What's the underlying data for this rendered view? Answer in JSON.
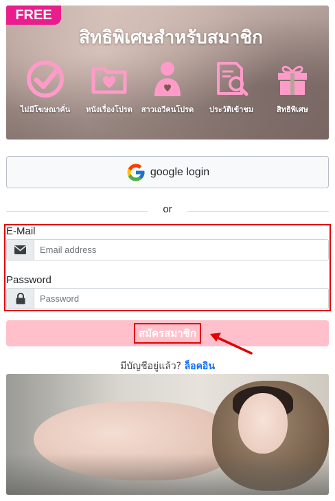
{
  "banner": {
    "badge": "FREE",
    "title": "สิทธิพิเศษสำหรับสมาชิก",
    "features": [
      {
        "label": "ไม่มีโฆษณาคั่น",
        "icon": "check-circle-icon"
      },
      {
        "label": "หนังเรื่องโปรด",
        "icon": "heart-folder-icon"
      },
      {
        "label": "สาวเอวีคนโปรด",
        "icon": "person-heart-icon"
      },
      {
        "label": "ประวัติเข้าชม",
        "icon": "history-document-icon"
      },
      {
        "label": "สิทธิพิเศษ",
        "icon": "gift-icon"
      }
    ],
    "accent": "#e91e8c"
  },
  "google": {
    "label": "google login"
  },
  "divider": {
    "text": "or"
  },
  "form": {
    "email_label": "E-Mail",
    "email_placeholder": "Email address",
    "password_label": "Password",
    "password_placeholder": "Password"
  },
  "register": {
    "label": "สมัครสมาชิก",
    "color": "#ffc0cb"
  },
  "login_prompt": {
    "text": "มีบัญชีอยู่แล้ว?",
    "link": "ล็อคอิน"
  },
  "colors": {
    "highlight": "#e00000",
    "link": "#0d6efd"
  }
}
